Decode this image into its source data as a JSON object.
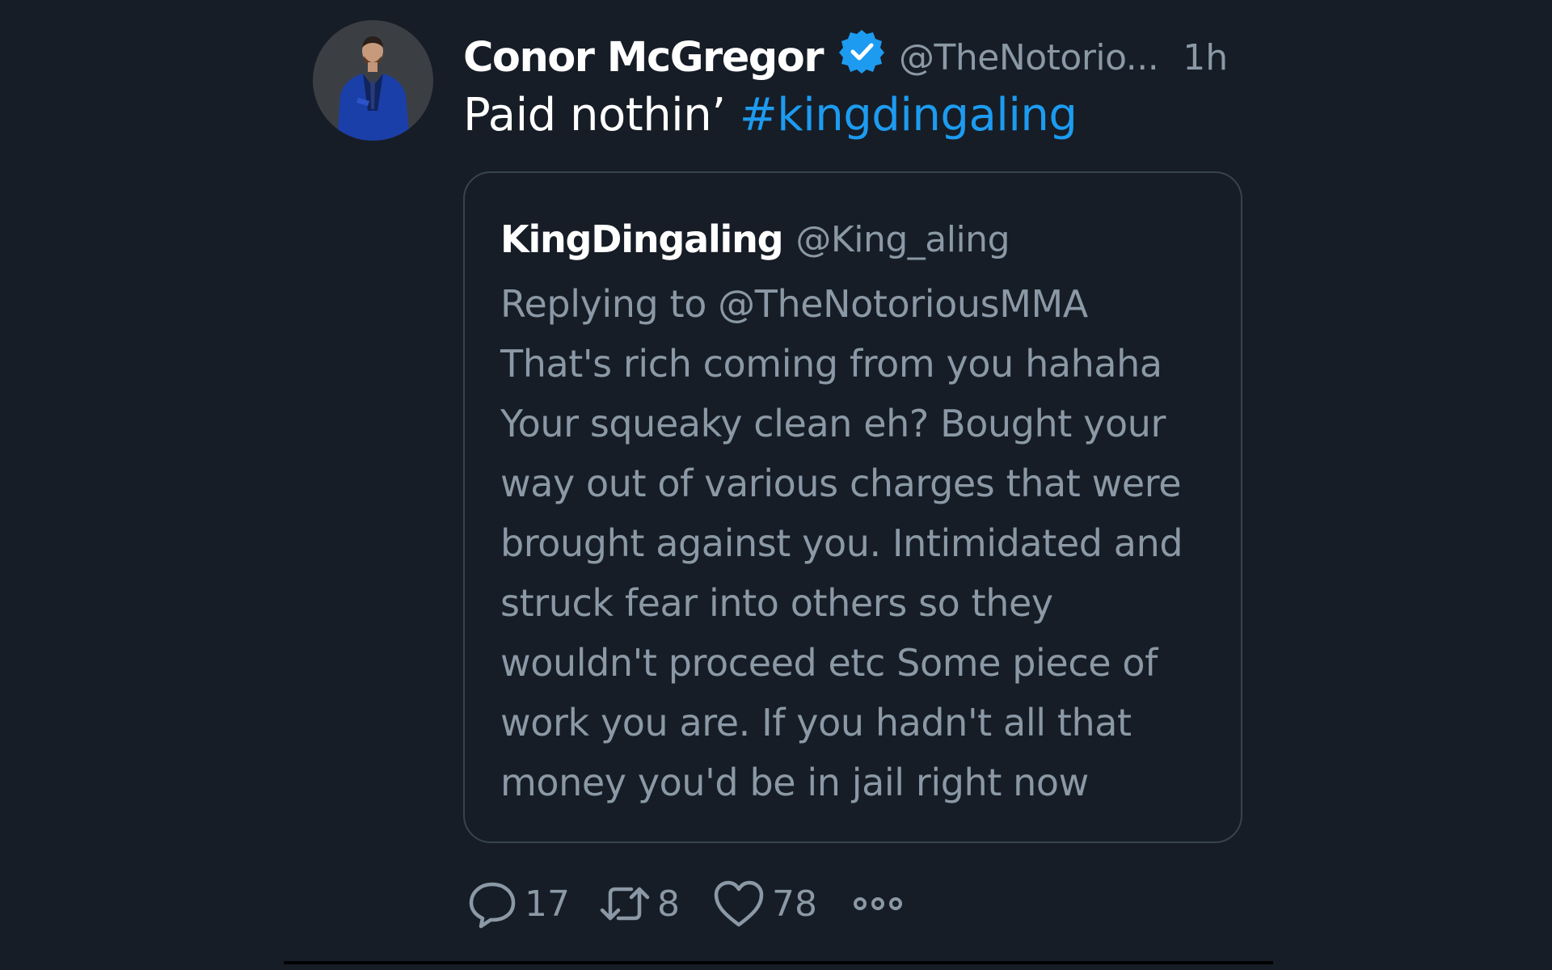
{
  "tweet": {
    "author": {
      "name": "Conor McGregor",
      "handle": "@TheNotorio...",
      "verified": true
    },
    "timestamp": "1h",
    "text": "Paid nothin’ ",
    "hashtag": "#kingdingaling",
    "quoted": {
      "name": "KingDingaling",
      "handle": "@King_aling",
      "replying_to": "Replying to @TheNotoriousMMA",
      "lines": [
        "That's rich coming from you hahaha",
        "Your squeaky clean eh? Bought your",
        "way out of various charges that were",
        "brought against you. Intimidated and",
        "struck fear into others so they",
        "wouldn't proceed etc Some piece of",
        "work you are. If you hadn't all that",
        "money you'd be in jail right now"
      ]
    },
    "actions": {
      "reply": {
        "icon": "reply-icon",
        "count": "17"
      },
      "retweet": {
        "icon": "retweet-icon",
        "count": "8"
      },
      "like": {
        "icon": "heart-icon",
        "count": "78"
      },
      "more": {
        "icon": "more-icon"
      }
    }
  },
  "colors": {
    "background": "#161d26",
    "text_primary": "#ffffff",
    "text_secondary": "#8b98a5",
    "accent": "#1d9bf0",
    "border": "#38444d"
  }
}
